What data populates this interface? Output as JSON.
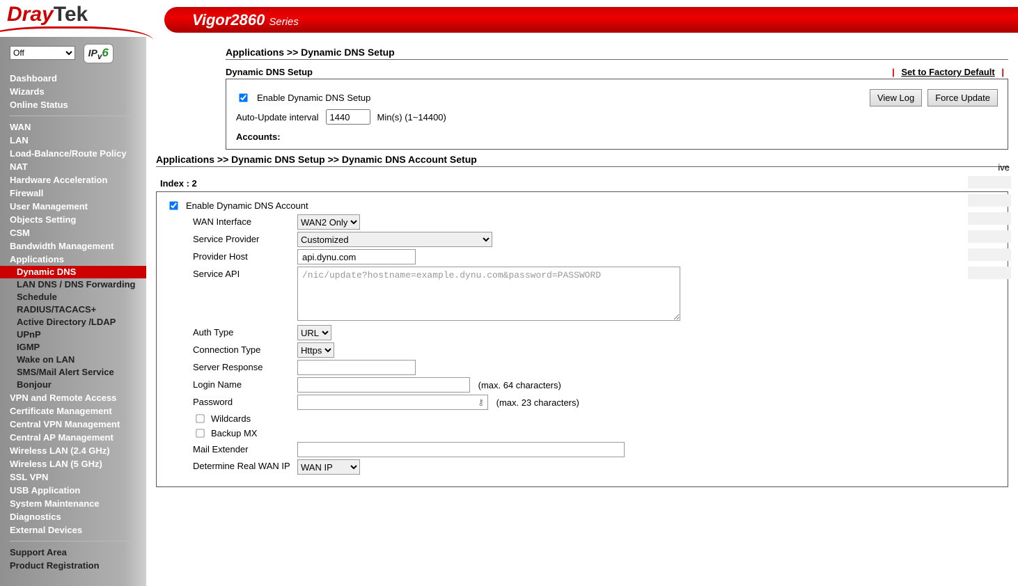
{
  "brand": {
    "part1": "Dray",
    "part2": "Tek",
    "model": "Vigor2860",
    "series": "Series"
  },
  "sidebar": {
    "mode_select": "Off",
    "ipv6_badge": "IPv6",
    "top1": [
      "Dashboard",
      "Wizards",
      "Online Status"
    ],
    "top2": [
      "WAN",
      "LAN",
      "Load-Balance/Route Policy",
      "NAT",
      "Hardware Acceleration",
      "Firewall",
      "User Management",
      "Objects Setting",
      "CSM",
      "Bandwidth Management",
      "Applications"
    ],
    "apps_sub": [
      "Dynamic DNS",
      "LAN DNS / DNS Forwarding",
      "Schedule",
      "RADIUS/TACACS+",
      "Active Directory /LDAP",
      "UPnP",
      "IGMP",
      "Wake on LAN",
      "SMS/Mail Alert Service",
      "Bonjour"
    ],
    "top3": [
      "VPN and Remote Access",
      "Certificate Management",
      "Central VPN Management",
      "Central AP Management",
      "Wireless LAN (2.4 GHz)",
      "Wireless LAN (5 GHz)",
      "SSL VPN",
      "USB Application",
      "System Maintenance",
      "Diagnostics",
      "External Devices"
    ],
    "bottom": [
      "Support Area",
      "Product Registration"
    ]
  },
  "page1": {
    "breadcrumb": "Applications >> Dynamic DNS Setup",
    "section_title": "Dynamic DNS Setup",
    "factory_link": "Set to Factory Default",
    "enable_label": "Enable Dynamic DNS Setup",
    "auto_update_label": "Auto-Update interval",
    "auto_update_value": "1440",
    "auto_update_suffix": "Min(s) (1~14400)",
    "view_log": "View Log",
    "force_update": "Force Update",
    "accounts_label": "Accounts:",
    "partial_col": "ive"
  },
  "page2": {
    "breadcrumb": "Applications >> Dynamic DNS Setup >> Dynamic DNS Account Setup",
    "index_label": "Index : 2",
    "enable_account": "Enable Dynamic DNS Account",
    "labels": {
      "wan_if": "WAN Interface",
      "svc_provider": "Service Provider",
      "provider_host": "Provider Host",
      "service_api": "Service API",
      "auth_type": "Auth Type",
      "conn_type": "Connection Type",
      "server_resp": "Server Response",
      "login": "Login Name",
      "password": "Password",
      "wildcards": "Wildcards",
      "backup_mx": "Backup MX",
      "mail_ext": "Mail Extender",
      "det_wan": "Determine Real WAN IP"
    },
    "values": {
      "wan_if": "WAN2 Only",
      "svc_provider": "Customized",
      "provider_host": "api.dynu.com",
      "service_api": "/nic/update?hostname=example.dynu.com&password=PASSWORD",
      "auth_type": "URL",
      "conn_type": "Https",
      "server_resp": "",
      "login": "",
      "password": "",
      "mail_ext": "",
      "det_wan": "WAN IP"
    },
    "hints": {
      "login": "(max. 64 characters)",
      "password": "(max. 23 characters)"
    }
  }
}
